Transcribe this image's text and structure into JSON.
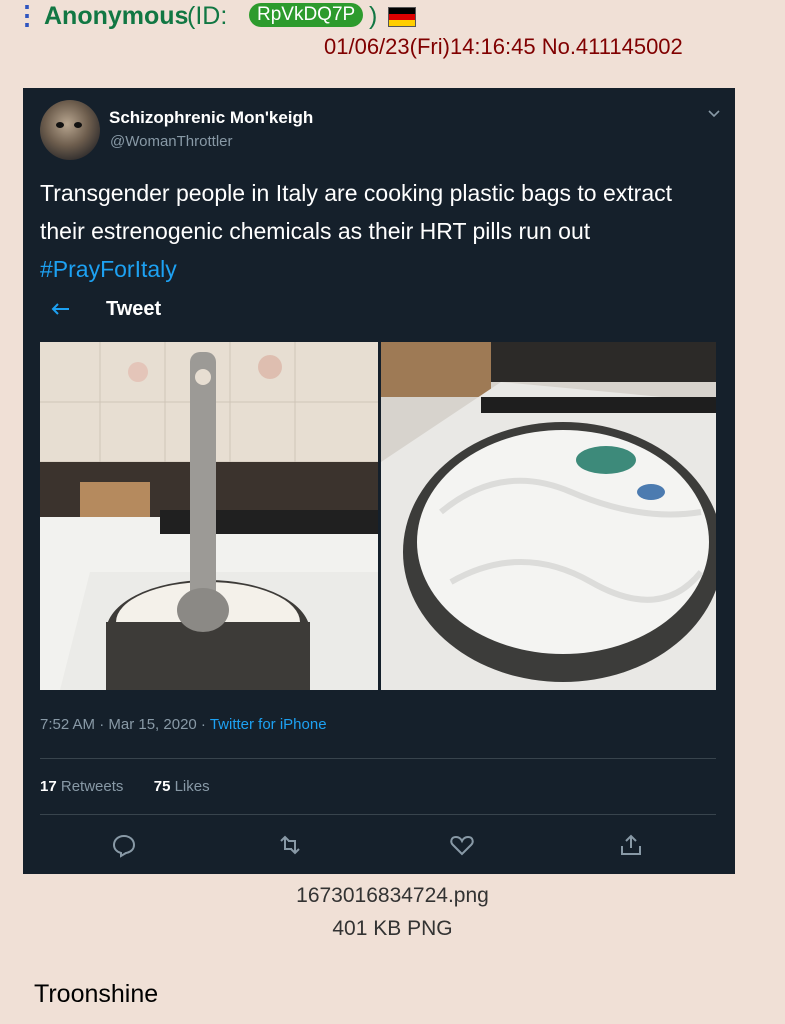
{
  "post": {
    "menu_icon": "vertical-dots-icon",
    "name": "Anonymous",
    "id_prefix": "(ID:",
    "id_value": "RpVkDQ7P",
    "id_suffix": ")",
    "flag_icon": "germany-flag-icon",
    "flag_colors": [
      "#000000",
      "#dd0000",
      "#ffce00"
    ],
    "timestamp": "01/06/23(Fri)14:16:45 No.411145002",
    "file_name": "1673016834724.png",
    "file_size": "401 KB PNG",
    "comment": "Troonshine"
  },
  "tweet": {
    "display_name": "Schizophrenic Mon'keigh",
    "handle": "@WomanThrottler",
    "text_main": "Transgender people in Italy are cooking plastic bags to extract their estrenogenic chemicals as their HRT pills run out ",
    "hashtag": "#PrayForItaly",
    "header_label": "Tweet",
    "time": "7:52 AM · Mar 15, 2020 · ",
    "source": "Twitter for iPhone",
    "retweets_count": "17",
    "retweets_label": "Retweets",
    "likes_count": "75",
    "likes_label": "Likes",
    "actions": [
      "reply-icon",
      "retweet-icon",
      "like-icon",
      "share-icon"
    ]
  },
  "colors": {
    "board_bg": "#f0e0d6",
    "name_green": "#117743",
    "timestamp_red": "#800000",
    "tweet_bg": "#15202b",
    "twitter_blue": "#1da1f2"
  }
}
